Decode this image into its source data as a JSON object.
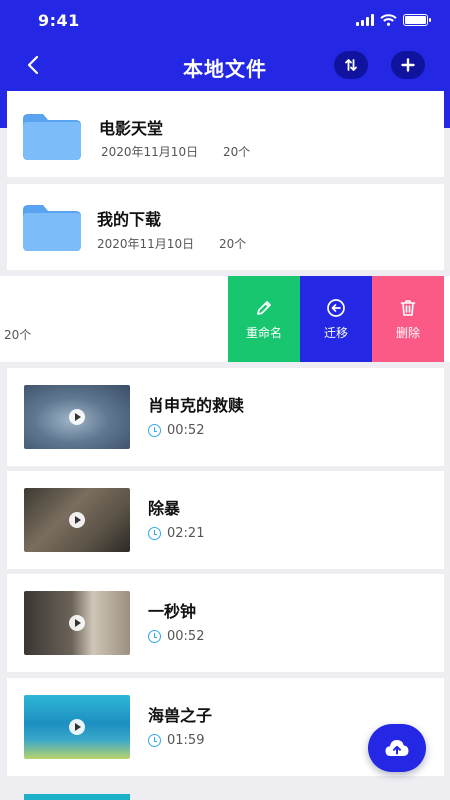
{
  "status_bar": {
    "time": "9:41"
  },
  "header": {
    "title": "本地文件"
  },
  "icons": {
    "back": "chevron-left-icon",
    "sort": "sort-arrows-icon",
    "add": "plus-icon",
    "upload": "cloud-upload-icon"
  },
  "folders": [
    {
      "name": "电影天堂",
      "date": "2020年11月10日",
      "count": "20个"
    },
    {
      "name": "我的下载",
      "date": "2020年11月10日",
      "count": "20个"
    }
  ],
  "swiped_row": {
    "count": "20个",
    "actions": [
      {
        "label": "重命名",
        "icon": "pencil-icon"
      },
      {
        "label": "迁移",
        "icon": "arrow-left-circle-icon"
      },
      {
        "label": "删除",
        "icon": "trash-icon"
      }
    ]
  },
  "videos": [
    {
      "title": "肖申克的救赎",
      "duration": "00:52"
    },
    {
      "title": "除暴",
      "duration": "02:21"
    },
    {
      "title": "一秒钟",
      "duration": "00:52"
    },
    {
      "title": "海兽之子",
      "duration": "01:59"
    }
  ],
  "colors": {
    "primary": "#2427e4",
    "rename": "#18c670",
    "delete": "#fb5a87",
    "folder": "#6fb3f7",
    "clock": "#35a8e8"
  }
}
